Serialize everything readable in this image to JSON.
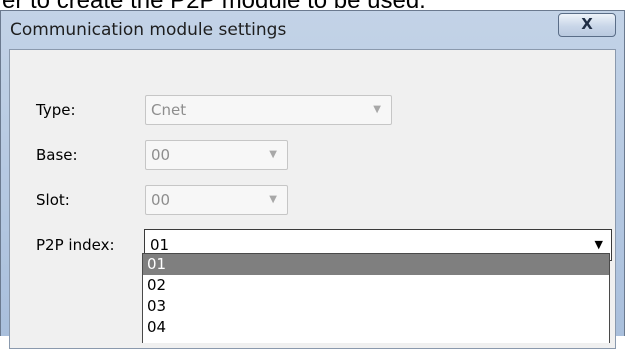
{
  "doc_fragment": "er to create the P2P module to be used.",
  "dialog": {
    "title": "Communication module settings",
    "close_label": "X"
  },
  "fields": {
    "type": {
      "label": "Type:",
      "value": "Cnet"
    },
    "base": {
      "label": "Base:",
      "value": "00"
    },
    "slot": {
      "label": "Slot:",
      "value": "00"
    },
    "p2p_index": {
      "label": "P2P index:",
      "value": "01"
    }
  },
  "p2p_options": [
    "01",
    "02",
    "03",
    "04"
  ],
  "selected_option": "01"
}
